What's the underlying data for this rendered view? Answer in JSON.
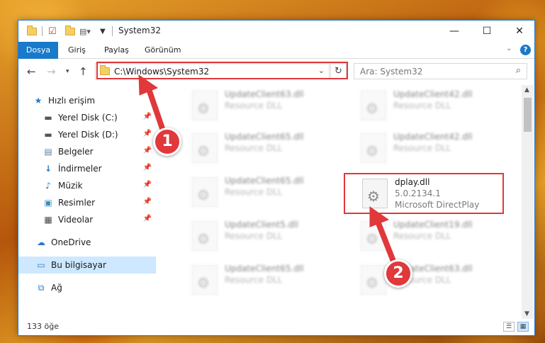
{
  "window": {
    "title": "System32",
    "controls": {
      "minimize": "—",
      "maximize": "☐",
      "close": "✕"
    }
  },
  "ribbon": {
    "tabs": [
      "Dosya",
      "Giriş",
      "Paylaş",
      "Görünüm"
    ],
    "expand_icon": "chevron-down-icon",
    "help": "?"
  },
  "address": {
    "path": "C:\\Windows\\System32",
    "search_placeholder": "Ara: System32"
  },
  "nav": {
    "items": [
      {
        "label": "Hızlı erişim",
        "icon": "star-icon",
        "pinned": false,
        "selected": false
      },
      {
        "label": "Yerel Disk (C:)",
        "icon": "drive-icon",
        "pinned": true,
        "selected": false
      },
      {
        "label": "Yerel Disk (D:)",
        "icon": "drive-icon",
        "pinned": true,
        "selected": false
      },
      {
        "label": "Belgeler",
        "icon": "document-icon",
        "pinned": true,
        "selected": false
      },
      {
        "label": "İndirmeler",
        "icon": "download-icon",
        "pinned": true,
        "selected": false
      },
      {
        "label": "Müzik",
        "icon": "music-icon",
        "pinned": true,
        "selected": false
      },
      {
        "label": "Resimler",
        "icon": "pictures-icon",
        "pinned": true,
        "selected": false
      },
      {
        "label": "Videolar",
        "icon": "video-icon",
        "pinned": true,
        "selected": false
      },
      {
        "label": "OneDrive",
        "icon": "cloud-icon",
        "pinned": false,
        "selected": false
      },
      {
        "label": "Bu bilgisayar",
        "icon": "computer-icon",
        "pinned": false,
        "selected": true
      },
      {
        "label": "Ağ",
        "icon": "network-icon",
        "pinned": false,
        "selected": false
      }
    ]
  },
  "files": [
    {
      "name": "UpdateClient63.dll",
      "type": "Resource DLL"
    },
    {
      "name": "UpdateClient42.dll",
      "type": "Resource DLL"
    },
    {
      "name": "UpdateClient65.dll",
      "type": "Resource DLL"
    },
    {
      "name": "UpdateClient42.dll",
      "type": "Resource DLL"
    },
    {
      "name": "UpdateClient65.dll",
      "type": "Resource DLL"
    },
    {
      "name": "dplay.dll",
      "version": "5.0.2134.1",
      "type": "Microsoft DirectPlay"
    },
    {
      "name": "UpdateClient5.dll",
      "type": "Resource DLL"
    },
    {
      "name": "UpdateClient19.dll",
      "type": "Resource DLL"
    },
    {
      "name": "UpdateClient65.dll",
      "type": "Resource DLL"
    },
    {
      "name": "UpdateClient63.dll",
      "type": "Resource DLL"
    }
  ],
  "status": {
    "count": "133 öğe"
  },
  "annotations": {
    "step1": "1",
    "step2": "2",
    "color": "#e0383b"
  }
}
